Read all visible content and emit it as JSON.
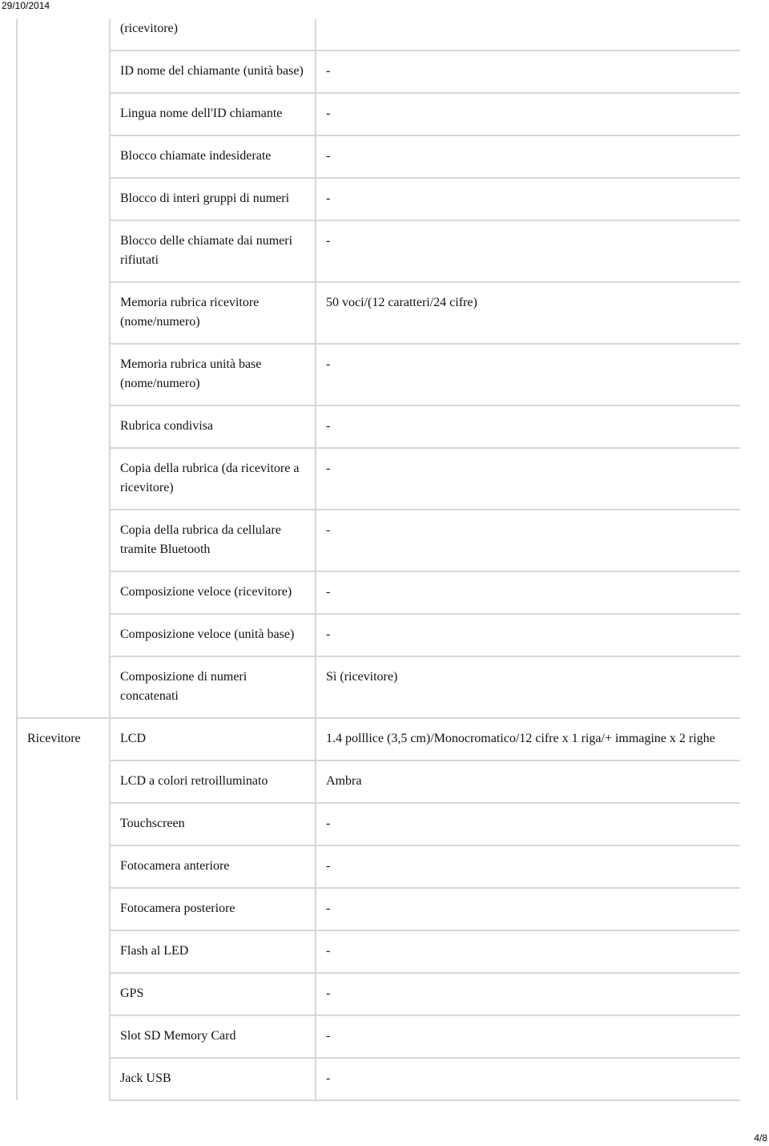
{
  "header": {
    "print_date": "29/10/2014"
  },
  "footer": {
    "page_number": "4/8"
  },
  "groups": [
    {
      "name": "",
      "rows": [
        {
          "label": "(ricevitore)",
          "value": ""
        },
        {
          "label": "ID nome del chiamante (unità base)",
          "value": "-"
        },
        {
          "label": "Lingua nome dell'ID chiamante",
          "value": "-"
        },
        {
          "label": "Blocco chiamate indesiderate",
          "value": "-"
        },
        {
          "label": "Blocco di interi gruppi di numeri",
          "value": "-"
        },
        {
          "label": "Blocco delle chiamate dai numeri rifiutati",
          "value": "-"
        },
        {
          "label": "Memoria rubrica ricevitore (nome/numero)",
          "value": "50 voci/(12 caratteri/24 cifre)"
        },
        {
          "label": "Memoria rubrica unità base (nome/numero)",
          "value": "-"
        },
        {
          "label": "Rubrica condivisa",
          "value": "-"
        },
        {
          "label": "Copia della rubrica (da ricevitore a ricevitore)",
          "value": "-"
        },
        {
          "label": "Copia della rubrica da cellulare tramite Bluetooth",
          "value": "-"
        },
        {
          "label": "Composizione veloce (ricevitore)",
          "value": "-"
        },
        {
          "label": "Composizione veloce (unità base)",
          "value": "-"
        },
        {
          "label": "Composizione di numeri concatenati",
          "value": "Sì (ricevitore)"
        }
      ]
    },
    {
      "name": "Ricevitore",
      "rows": [
        {
          "label": "LCD",
          "value": "1.4 polllice (3,5 cm)/Monocromatico/12 cifre x 1 riga/+ immagine x 2 righe"
        },
        {
          "label": "LCD a colori retroilluminato",
          "value": "Ambra"
        },
        {
          "label": "Touchscreen",
          "value": "-"
        },
        {
          "label": "Fotocamera anteriore",
          "value": "-"
        },
        {
          "label": "Fotocamera posteriore",
          "value": "-"
        },
        {
          "label": "Flash al LED",
          "value": "-"
        },
        {
          "label": "GPS",
          "value": "-"
        },
        {
          "label": "Slot SD Memory Card",
          "value": "-"
        },
        {
          "label": "Jack USB",
          "value": "-"
        }
      ]
    }
  ]
}
